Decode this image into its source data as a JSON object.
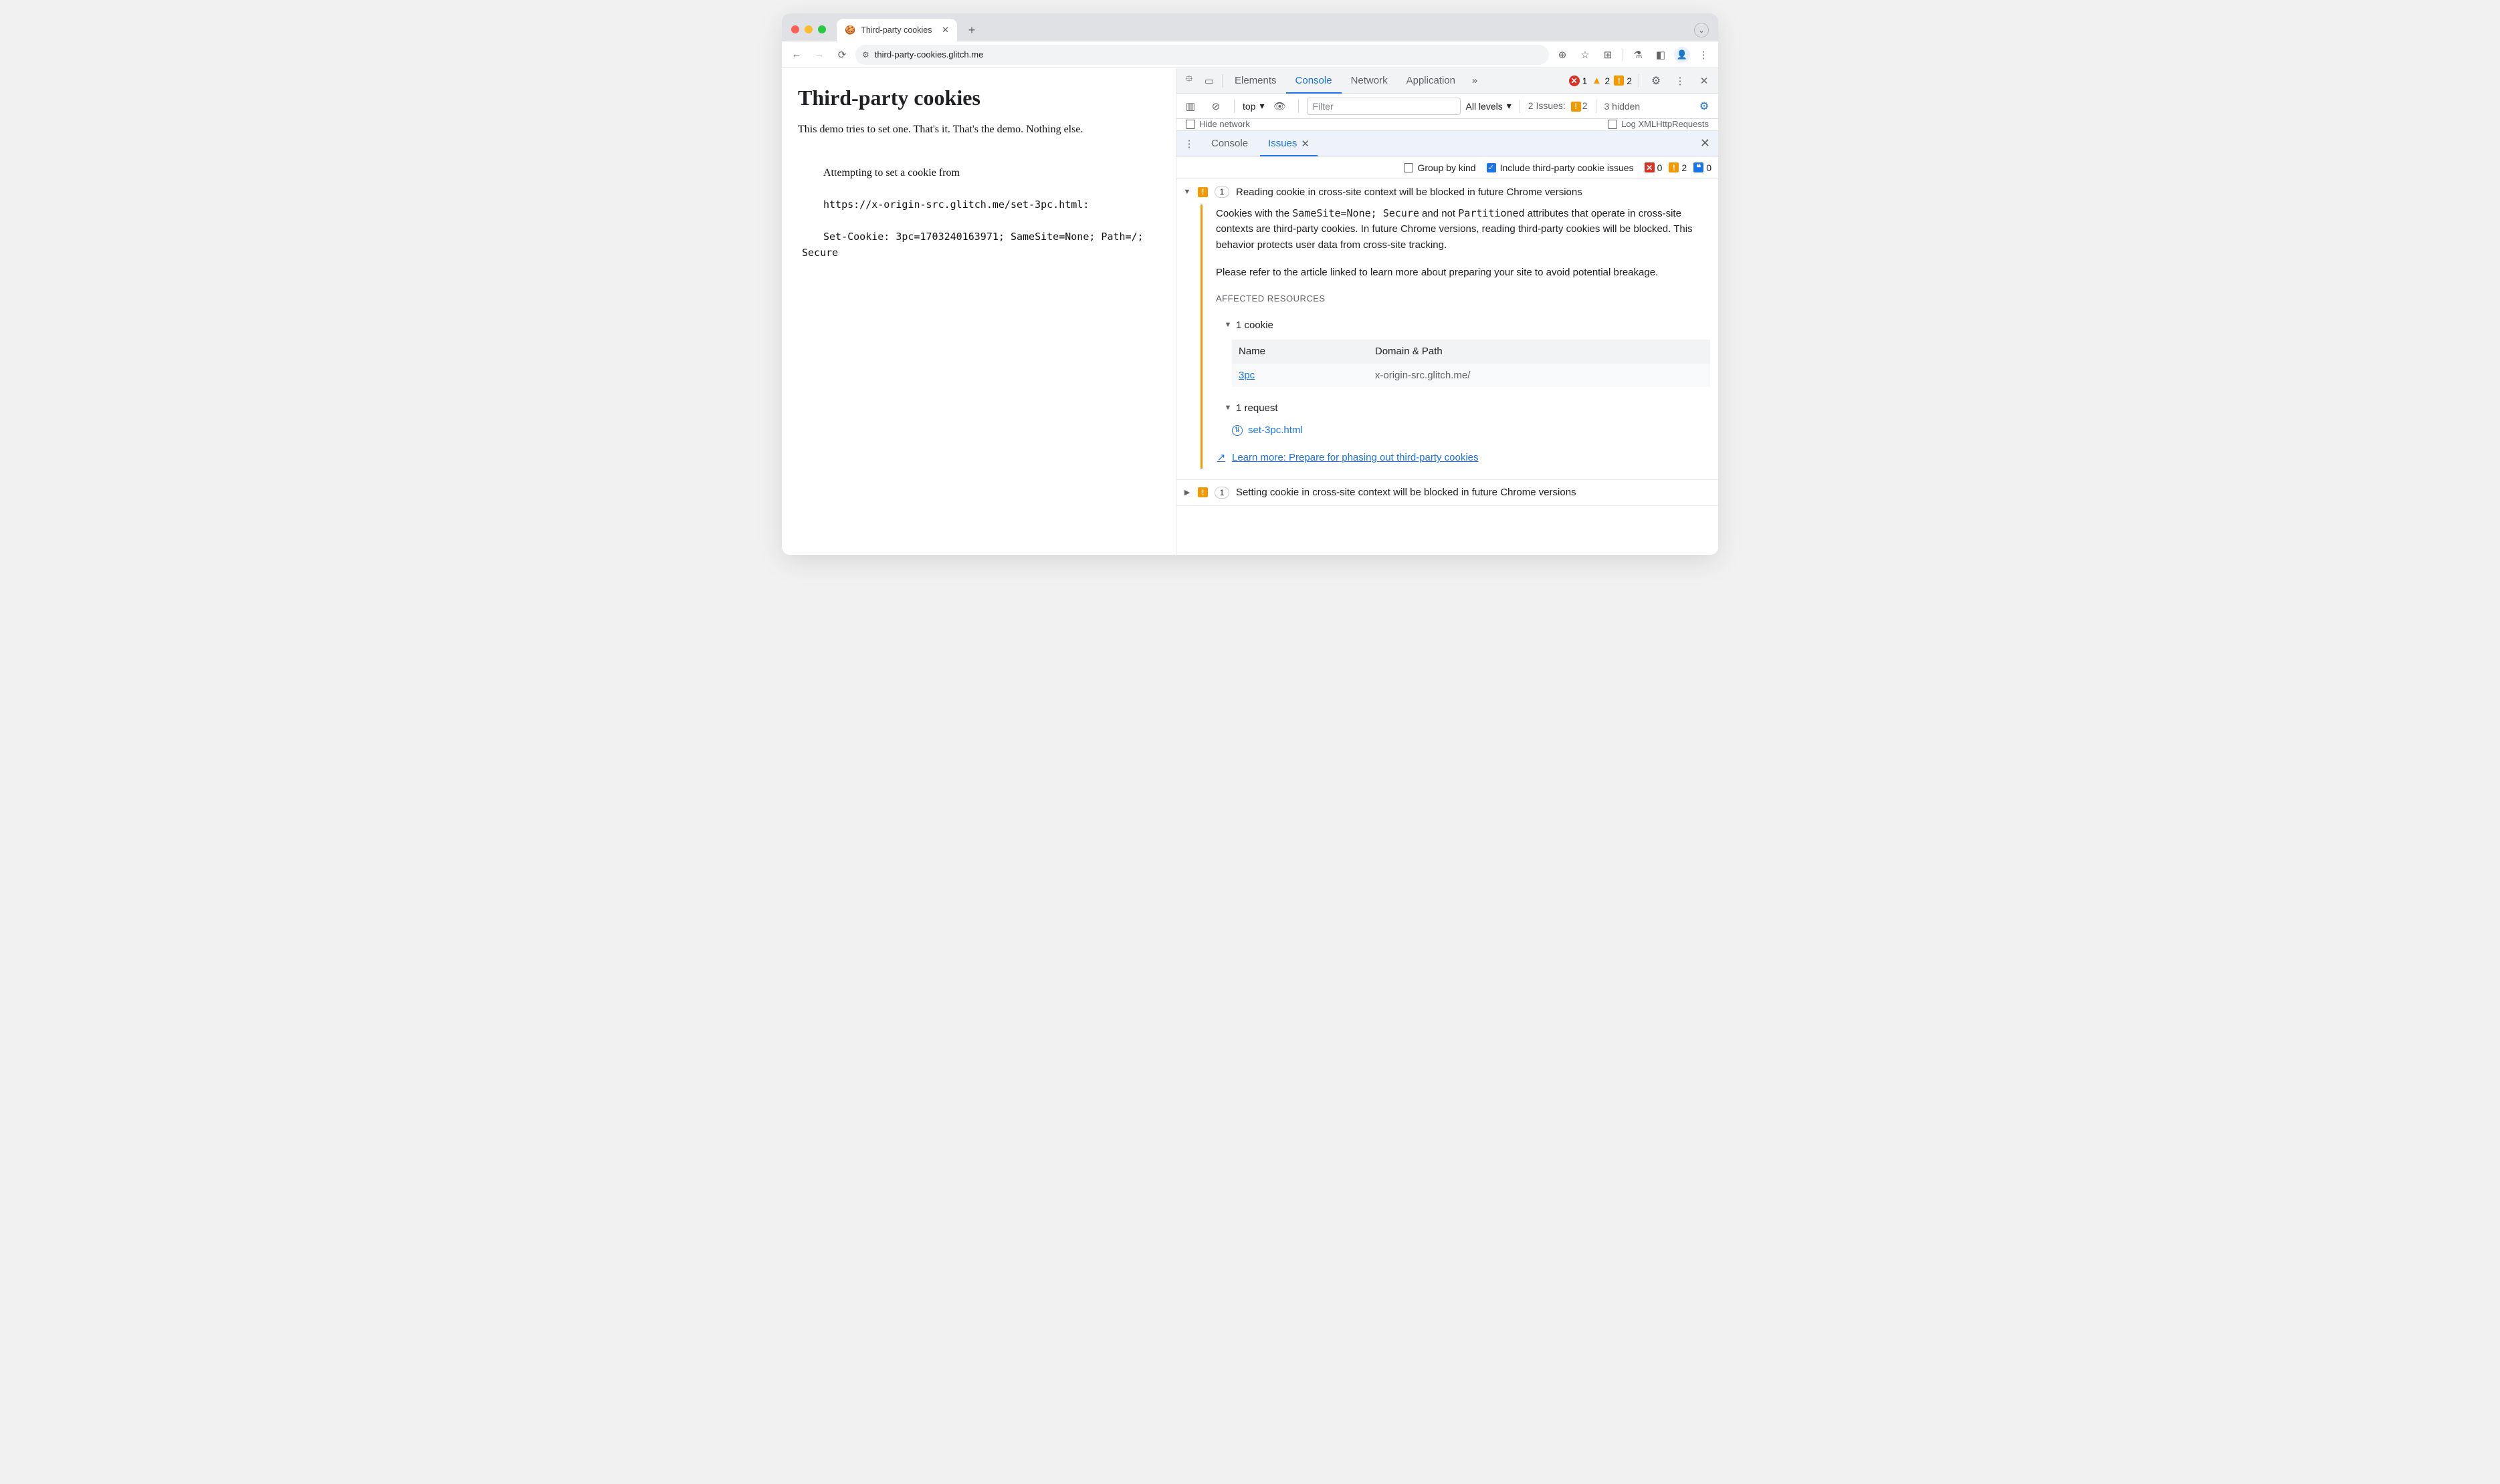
{
  "browser": {
    "tab_title": "Third-party cookies",
    "url": "third-party-cookies.glitch.me"
  },
  "page": {
    "heading": "Third-party cookies",
    "paragraph": "This demo tries to set one. That's it. That's the demo. Nothing else.",
    "log_line1": "Attempting to set a cookie from",
    "log_line2": "https://x-origin-src.glitch.me/set-3pc.html:",
    "log_line3": "Set-Cookie: 3pc=1703240163971; SameSite=None; Path=/; Secure"
  },
  "devtools": {
    "tabs": {
      "elements": "Elements",
      "console": "Console",
      "network": "Network",
      "application": "Application"
    },
    "counts": {
      "errors": "1",
      "warnings": "2",
      "issues_badge": "2"
    },
    "console_row": {
      "context": "top",
      "filter_placeholder": "Filter",
      "levels": "All levels",
      "issues_label": "2 Issues:",
      "issues_count": "2",
      "hidden": "3 hidden"
    },
    "hints": {
      "hide_network": "Hide network",
      "log_xhr": "Log XMLHttpRequests"
    },
    "drawer": {
      "console": "Console",
      "issues": "Issues"
    },
    "issues_toolbar": {
      "group_by_kind": "Group by kind",
      "include_3p": "Include third-party cookie issues",
      "red": "0",
      "yellow": "2",
      "blue": "0"
    },
    "issues": [
      {
        "count": "1",
        "title": "Reading cookie in cross-site context will be blocked in future Chrome versions",
        "body_p1a": "Cookies with the ",
        "body_p1_code1": "SameSite=None; Secure",
        "body_p1b": " and not ",
        "body_p1_code2": "Partitioned",
        "body_p1c": " attributes that operate in cross-site contexts are third-party cookies. In future Chrome versions, reading third-party cookies will be blocked. This behavior protects user data from cross-site tracking.",
        "body_p2": "Please refer to the article linked to learn more about preparing your site to avoid potential breakage.",
        "affected_label": "Affected Resources",
        "cookies_label": "1 cookie",
        "cookie_table": {
          "h1": "Name",
          "h2": "Domain & Path",
          "name": "3pc",
          "domain": "x-origin-src.glitch.me/"
        },
        "requests_label": "1 request",
        "request_name": "set-3pc.html",
        "learn_more": "Learn more: Prepare for phasing out third-party cookies"
      },
      {
        "count": "1",
        "title": "Setting cookie in cross-site context will be blocked in future Chrome versions"
      }
    ]
  }
}
